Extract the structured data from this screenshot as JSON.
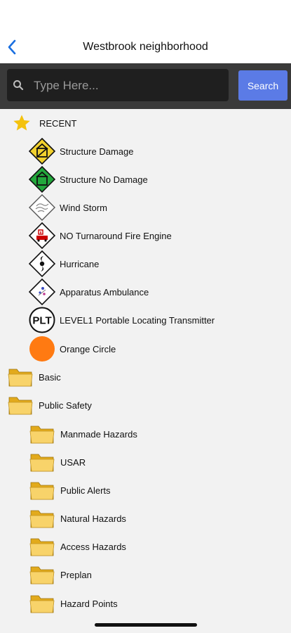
{
  "header": {
    "title": "Westbrook neighborhood",
    "back_icon": "chevron-left-icon"
  },
  "search": {
    "placeholder": "Type Here...",
    "value": "",
    "button_label": "Search"
  },
  "colors": {
    "accent": "#5b7be6",
    "search_bg": "#3a3a3a",
    "folder": "#f5c542"
  },
  "recent": {
    "label": "RECENT",
    "icon": "star-icon",
    "items": [
      {
        "label": "Structure Damage",
        "icon": "structure-damage-icon"
      },
      {
        "label": "Structure No Damage",
        "icon": "structure-no-damage-icon"
      },
      {
        "label": "Wind Storm",
        "icon": "wind-storm-icon"
      },
      {
        "label": "NO Turnaround Fire Engine",
        "icon": "fire-engine-icon"
      },
      {
        "label": "Hurricane",
        "icon": "hurricane-icon"
      },
      {
        "label": "Apparatus Ambulance",
        "icon": "ambulance-icon"
      },
      {
        "label": "LEVEL1 Portable Locating Transmitter",
        "icon": "plt-icon",
        "icon_text": "PLT"
      },
      {
        "label": "Orange Circle",
        "icon": "orange-circle-icon"
      }
    ]
  },
  "folders": [
    {
      "label": "Basic",
      "icon": "folder-icon"
    },
    {
      "label": "Public Safety",
      "icon": "folder-icon",
      "children": [
        {
          "label": "Manmade Hazards",
          "icon": "folder-icon"
        },
        {
          "label": "USAR",
          "icon": "folder-icon"
        },
        {
          "label": "Public Alerts",
          "icon": "folder-icon"
        },
        {
          "label": "Natural Hazards",
          "icon": "folder-icon"
        },
        {
          "label": "Access Hazards",
          "icon": "folder-icon"
        },
        {
          "label": "Preplan",
          "icon": "folder-icon"
        },
        {
          "label": "Hazard Points",
          "icon": "folder-icon"
        }
      ]
    }
  ]
}
